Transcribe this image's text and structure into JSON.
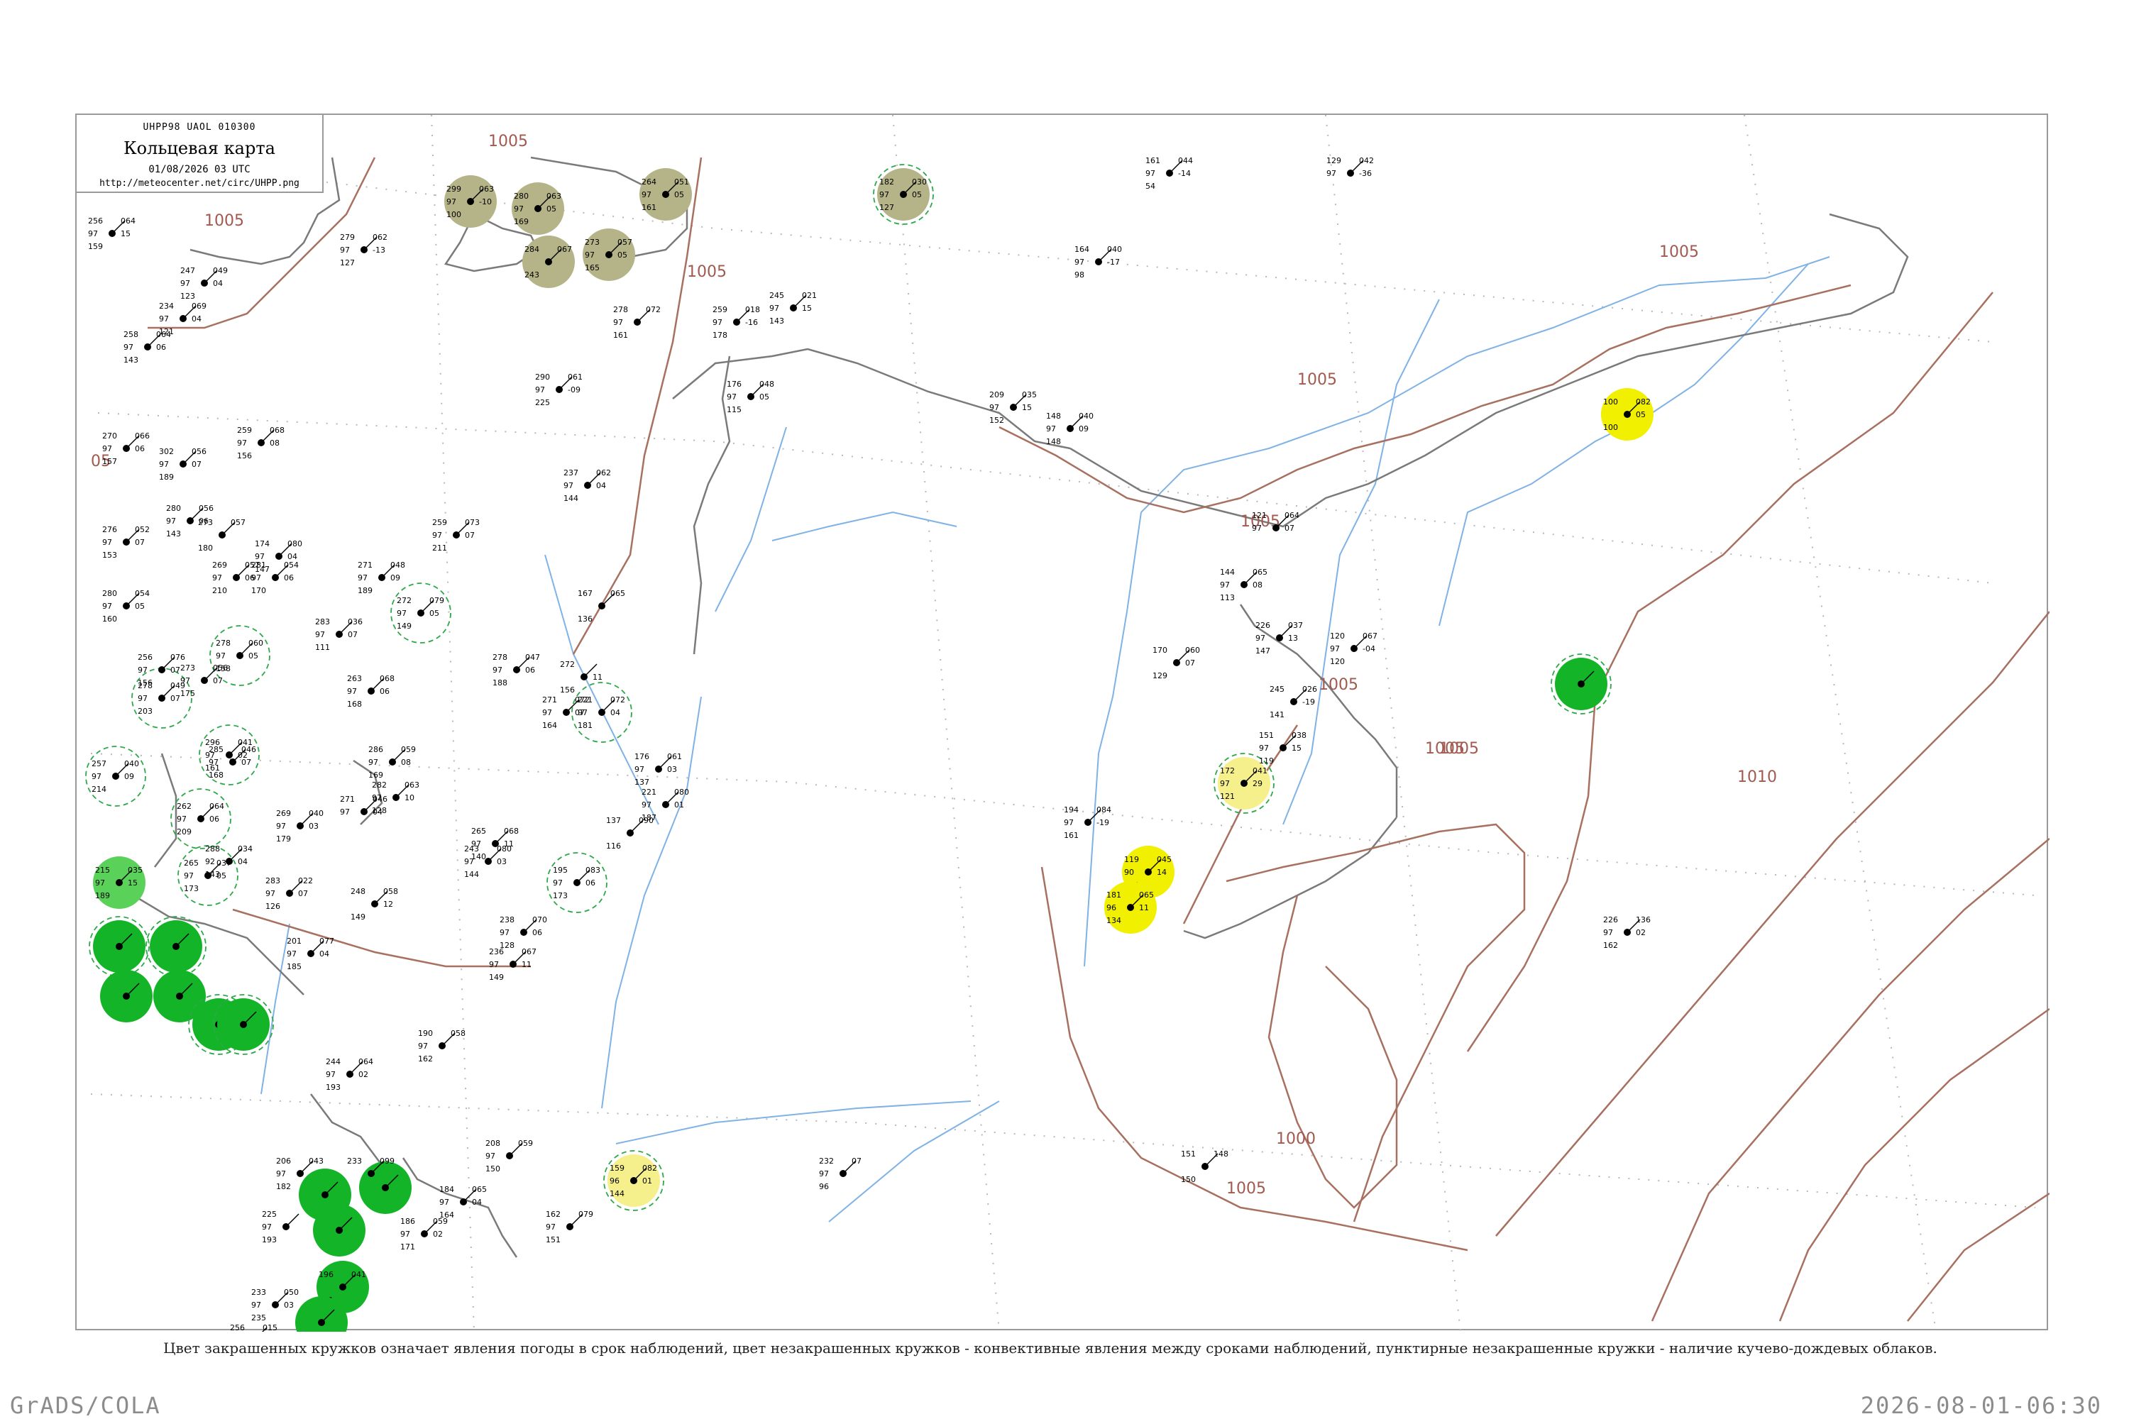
{
  "header": {
    "code": "UHPP98  UAOL  010300",
    "title": "Кольцевая карта",
    "date": "01/08/2026 03 UTC",
    "url": "http://meteocenter.net/circ/UHPP.png"
  },
  "legend_note": "Цвет закрашенных кружков означает явления погоды в срок наблюдений, цвет незакрашенных кружков - конвективные явления между сроками наблюдений, пунктирные незакрашенные кружки - наличие кучево-дождевых облаков.",
  "footer": {
    "left": "GrADS/COLA",
    "right": "2026-08-01-06:30"
  },
  "colors": {
    "isobar": "#a87060",
    "coast": "#7a7a7a",
    "river": "#7fb2e5",
    "grid": "#b8b8b8",
    "fog_olive": "#b4b488",
    "rain_green": "#14b428",
    "drizzle_light_green": "#5ad25a",
    "haze_yellow": "#f0f000",
    "pale_yellow": "#f5f08c",
    "cb_ring": "#2ea84a"
  },
  "isobar_labels": [
    "1005",
    "1005",
    "1005",
    "1005",
    "1005",
    "1005",
    "1005",
    "1005",
    "1005",
    "1005",
    "1000",
    "1010",
    "05"
  ],
  "stations": [
    {
      "p": "299",
      "t": "063",
      "d": "-10",
      "v": "97",
      "h": "100",
      "marker": "fog"
    },
    {
      "p": "280",
      "t": "063",
      "d": "05",
      "v": "97",
      "h": "169",
      "marker": "fog"
    },
    {
      "p": "264",
      "t": "051",
      "d": "05",
      "v": "97",
      "h": "161",
      "marker": "fog"
    },
    {
      "p": "284",
      "t": "067",
      "d": "",
      "v": "",
      "h": "243",
      "marker": "fog"
    },
    {
      "p": "273",
      "t": "057",
      "d": "05",
      "v": "97",
      "h": "165",
      "marker": "fog"
    },
    {
      "p": "182",
      "t": "030",
      "d": "05",
      "v": "97",
      "h": "127",
      "marker": "fog-cb"
    },
    {
      "p": "100",
      "t": "082",
      "d": "05",
      "v": "",
      "h": "100",
      "marker": "haze"
    },
    {
      "p": "172",
      "t": "041",
      "d": "29",
      "v": "97",
      "h": "121",
      "marker": "pale"
    },
    {
      "p": "119",
      "t": "045",
      "d": "14",
      "v": "90",
      "h": "118",
      "marker": "haze"
    },
    {
      "p": "181",
      "t": "065",
      "d": "11",
      "v": "96",
      "h": "134",
      "marker": "haze"
    },
    {
      "p": "159",
      "t": "082",
      "d": "01",
      "v": "96",
      "h": "144",
      "marker": "pale"
    },
    {
      "p": "215",
      "t": "035",
      "d": "15",
      "v": "97",
      "h": "189",
      "marker": "drizzle"
    },
    {
      "p": "",
      "t": "",
      "d": "",
      "v": "",
      "h": "",
      "marker": "rain-cb"
    },
    {
      "p": "",
      "t": "",
      "d": "",
      "v": "",
      "h": "",
      "marker": "rain-cb"
    },
    {
      "p": "",
      "t": "",
      "d": "",
      "v": "",
      "h": "",
      "marker": "rain"
    },
    {
      "p": "",
      "t": "",
      "d": "",
      "v": "",
      "h": "",
      "marker": "rain"
    },
    {
      "p": "",
      "t": "",
      "d": "",
      "v": "",
      "h": "",
      "marker": "rain-cb"
    },
    {
      "p": "",
      "t": "",
      "d": "",
      "v": "",
      "h": "",
      "marker": "rain-cb"
    },
    {
      "p": "",
      "t": "",
      "d": "",
      "v": "",
      "h": "",
      "marker": "rain"
    },
    {
      "p": "",
      "t": "",
      "d": "",
      "v": "",
      "h": "",
      "marker": "rain"
    },
    {
      "p": "",
      "t": "",
      "d": "",
      "v": "",
      "h": "",
      "marker": "rain"
    },
    {
      "p": "196",
      "t": "041",
      "d": "",
      "v": "",
      "h": "191",
      "marker": "rain"
    },
    {
      "p": "",
      "t": "",
      "d": "",
      "v": "",
      "h": "",
      "marker": "rain"
    },
    {
      "p": "",
      "t": "",
      "d": "",
      "v": "",
      "h": "",
      "marker": "rain-cb"
    },
    {
      "p": "278",
      "t": "060",
      "d": "05",
      "v": "97",
      "h": "158",
      "marker": "cb"
    },
    {
      "p": "272",
      "t": "079",
      "d": "05",
      "v": "97",
      "h": "149",
      "marker": "cb"
    },
    {
      "p": "278",
      "t": "049",
      "d": "07",
      "v": "97",
      "h": "203",
      "marker": "cb"
    },
    {
      "p": "257",
      "t": "040",
      "d": "09",
      "v": "97",
      "h": "214",
      "marker": "cb"
    },
    {
      "p": "296",
      "t": "041",
      "d": "02",
      "v": "97",
      "h": "161",
      "marker": "cb"
    },
    {
      "p": "262",
      "t": "064",
      "d": "06",
      "v": "97",
      "h": "209",
      "marker": "cb"
    },
    {
      "p": "265",
      "t": "037",
      "d": "05",
      "v": "97",
      "h": "173",
      "marker": "cb"
    },
    {
      "p": "221",
      "t": "072",
      "d": "04",
      "v": "97",
      "h": "181",
      "marker": "cb"
    },
    {
      "p": "195",
      "t": "083",
      "d": "06",
      "v": "97",
      "h": "173",
      "marker": "cb"
    },
    {
      "p": "256",
      "t": "064",
      "d": "15",
      "v": "97",
      "h": "159",
      "marker": "plain"
    },
    {
      "p": "247",
      "t": "049",
      "d": "04",
      "v": "97",
      "h": "123",
      "marker": "plain"
    },
    {
      "p": "279",
      "t": "062",
      "d": "-13",
      "v": "97",
      "h": "127",
      "marker": "plain"
    },
    {
      "p": "234",
      "t": "069",
      "d": "04",
      "v": "97",
      "h": "121",
      "marker": "plain"
    },
    {
      "p": "258",
      "t": "064",
      "d": "06",
      "v": "97",
      "h": "143",
      "marker": "plain"
    },
    {
      "p": "278",
      "t": "072",
      "d": "",
      "v": "97",
      "h": "161",
      "marker": "plain"
    },
    {
      "p": "245",
      "t": "021",
      "d": "15",
      "v": "97",
      "h": "143",
      "marker": "plain"
    },
    {
      "p": "259",
      "t": "018",
      "d": "-16",
      "v": "97",
      "h": "178",
      "marker": "plain"
    },
    {
      "p": "161",
      "t": "044",
      "d": "-14",
      "v": "97",
      "h": "54",
      "marker": "plain"
    },
    {
      "p": "129",
      "t": "042",
      "d": "-36",
      "v": "97",
      "h": "",
      "marker": "plain"
    },
    {
      "p": "164",
      "t": "040",
      "d": "-17",
      "v": "97",
      "h": "98",
      "marker": "plain"
    },
    {
      "p": "290",
      "t": "061",
      "d": "-09",
      "v": "97",
      "h": "225",
      "marker": "plain"
    },
    {
      "p": "176",
      "t": "048",
      "d": "05",
      "v": "97",
      "h": "115",
      "marker": "plain"
    },
    {
      "p": "209",
      "t": "035",
      "d": "15",
      "v": "97",
      "h": "152",
      "marker": "plain"
    },
    {
      "p": "148",
      "t": "040",
      "d": "09",
      "v": "97",
      "h": "148",
      "marker": "plain"
    },
    {
      "p": "270",
      "t": "066",
      "d": "06",
      "v": "97",
      "h": "157",
      "marker": "plain"
    },
    {
      "p": "259",
      "t": "068",
      "d": "08",
      "v": "97",
      "h": "156",
      "marker": "plain"
    },
    {
      "p": "302",
      "t": "056",
      "d": "07",
      "v": "97",
      "h": "189",
      "marker": "plain"
    },
    {
      "p": "237",
      "t": "062",
      "d": "04",
      "v": "97",
      "h": "144",
      "marker": "plain"
    },
    {
      "p": "280",
      "t": "056",
      "d": "06",
      "v": "97",
      "h": "143",
      "marker": "plain"
    },
    {
      "p": "273",
      "t": "057",
      "d": "",
      "v": "",
      "h": "180",
      "marker": "plain"
    },
    {
      "p": "276",
      "t": "052",
      "d": "07",
      "v": "97",
      "h": "153",
      "marker": "plain"
    },
    {
      "p": "259",
      "t": "073",
      "d": "07",
      "v": "97",
      "h": "211",
      "marker": "plain"
    },
    {
      "p": "174",
      "t": "080",
      "d": "04",
      "v": "97",
      "h": "147",
      "marker": "plain"
    },
    {
      "p": "269",
      "t": "057",
      "d": "06",
      "v": "97",
      "h": "210",
      "marker": "plain"
    },
    {
      "p": "281",
      "t": "054",
      "d": "06",
      "v": "97",
      "h": "170",
      "marker": "plain"
    },
    {
      "p": "271",
      "t": "048",
      "d": "09",
      "v": "97",
      "h": "189",
      "marker": "plain"
    },
    {
      "p": "121",
      "t": "064",
      "d": "07",
      "v": "97",
      "h": "",
      "marker": "plain"
    },
    {
      "p": "280",
      "t": "054",
      "d": "05",
      "v": "97",
      "h": "160",
      "marker": "plain"
    },
    {
      "p": "167",
      "t": "065",
      "d": "",
      "v": "",
      "h": "136",
      "marker": "plain"
    },
    {
      "p": "144",
      "t": "065",
      "d": "08",
      "v": "97",
      "h": "113",
      "marker": "plain"
    },
    {
      "p": "283",
      "t": "036",
      "d": "07",
      "v": "97",
      "h": "111",
      "marker": "plain"
    },
    {
      "p": "226",
      "t": "037",
      "d": "13",
      "v": "97",
      "h": "147",
      "marker": "plain"
    },
    {
      "p": "120",
      "t": "067",
      "d": "-04",
      "v": "97",
      "h": "120",
      "marker": "plain"
    },
    {
      "p": "170",
      "t": "060",
      "d": "07",
      "v": "",
      "h": "129",
      "marker": "plain"
    },
    {
      "p": "278",
      "t": "047",
      "d": "06",
      "v": "97",
      "h": "188",
      "marker": "plain"
    },
    {
      "p": "272",
      "t": "",
      "d": "11",
      "v": "",
      "h": "156",
      "marker": "plain"
    },
    {
      "p": "256",
      "t": "076",
      "d": "07",
      "v": "97",
      "h": "156",
      "marker": "plain"
    },
    {
      "p": "273",
      "t": "056",
      "d": "07",
      "v": "97",
      "h": "175",
      "marker": "plain"
    },
    {
      "p": "263",
      "t": "068",
      "d": "06",
      "v": "97",
      "h": "168",
      "marker": "plain"
    },
    {
      "p": "271",
      "t": "072",
      "d": "07",
      "v": "97",
      "h": "164",
      "marker": "plain"
    },
    {
      "p": "245",
      "t": "026",
      "d": "-19",
      "v": "",
      "h": "141",
      "marker": "plain"
    },
    {
      "p": "151",
      "t": "038",
      "d": "15",
      "v": "97",
      "h": "119",
      "marker": "plain"
    },
    {
      "p": "285",
      "t": "046",
      "d": "07",
      "v": "97",
      "h": "168",
      "marker": "plain"
    },
    {
      "p": "286",
      "t": "059",
      "d": "08",
      "v": "97",
      "h": "169",
      "marker": "plain"
    },
    {
      "p": "176",
      "t": "061",
      "d": "03",
      "v": "97",
      "h": "137",
      "marker": "plain"
    },
    {
      "p": "194",
      "t": "084",
      "d": "-19",
      "v": "97",
      "h": "161",
      "marker": "plain"
    },
    {
      "p": "269",
      "t": "040",
      "d": "03",
      "v": "97",
      "h": "179",
      "marker": "plain"
    },
    {
      "p": "271",
      "t": "046",
      "d": "04",
      "v": "97",
      "h": "",
      "marker": "plain"
    },
    {
      "p": "282",
      "t": "063",
      "d": "10",
      "v": "97",
      "h": "128",
      "marker": "plain"
    },
    {
      "p": "221",
      "t": "080",
      "d": "01",
      "v": "97",
      "h": "187",
      "marker": "plain"
    },
    {
      "p": "137",
      "t": "090",
      "d": "",
      "v": "",
      "h": "116",
      "marker": "plain"
    },
    {
      "p": "265",
      "t": "068",
      "d": "11",
      "v": "97",
      "h": "140",
      "marker": "plain"
    },
    {
      "p": "288",
      "t": "034",
      "d": "04",
      "v": "92",
      "h": "143",
      "marker": "plain"
    },
    {
      "p": "283",
      "t": "022",
      "d": "07",
      "v": "97",
      "h": "126",
      "marker": "plain"
    },
    {
      "p": "243",
      "t": "080",
      "d": "03",
      "v": "97",
      "h": "144",
      "marker": "plain"
    },
    {
      "p": "248",
      "t": "058",
      "d": "12",
      "v": "",
      "h": "149",
      "marker": "plain"
    },
    {
      "p": "238",
      "t": "070",
      "d": "06",
      "v": "97",
      "h": "128",
      "marker": "plain"
    },
    {
      "p": "201",
      "t": "077",
      "d": "04",
      "v": "97",
      "h": "185",
      "marker": "plain"
    },
    {
      "p": "236",
      "t": "067",
      "d": "11",
      "v": "97",
      "h": "149",
      "marker": "plain"
    },
    {
      "p": "226",
      "t": "136",
      "d": "02",
      "v": "97",
      "h": "162",
      "marker": "plain"
    },
    {
      "p": "190",
      "t": "058",
      "d": "",
      "v": "97",
      "h": "162",
      "marker": "plain"
    },
    {
      "p": "244",
      "t": "064",
      "d": "02",
      "v": "97",
      "h": "193",
      "marker": "plain"
    },
    {
      "p": "232",
      "t": "07",
      "d": "",
      "v": "97",
      "h": "96",
      "marker": "plain"
    },
    {
      "p": "208",
      "t": "059",
      "d": "",
      "v": "97",
      "h": "150",
      "marker": "plain"
    },
    {
      "p": "184",
      "t": "065",
      "d": "04",
      "v": "97",
      "h": "164",
      "marker": "plain"
    },
    {
      "p": "206",
      "t": "043",
      "d": "",
      "v": "97",
      "h": "182",
      "marker": "plain"
    },
    {
      "p": "233",
      "t": "099",
      "d": "",
      "v": "",
      "h": "",
      "marker": "plain"
    },
    {
      "p": "225",
      "t": "",
      "d": "",
      "v": "97",
      "h": "193",
      "marker": "plain"
    },
    {
      "p": "233",
      "t": "050",
      "d": "03",
      "v": "97",
      "h": "235",
      "marker": "plain"
    },
    {
      "p": "256",
      "t": "015",
      "d": "03",
      "v": "96",
      "h": "251",
      "marker": "plain"
    },
    {
      "p": "162",
      "t": "079",
      "d": "",
      "v": "97",
      "h": "151",
      "marker": "plain"
    },
    {
      "p": "186",
      "t": "059",
      "d": "02",
      "v": "97",
      "h": "171",
      "marker": "plain"
    },
    {
      "p": "151",
      "t": "148",
      "d": "",
      "v": "",
      "h": "150",
      "marker": "plain"
    }
  ]
}
